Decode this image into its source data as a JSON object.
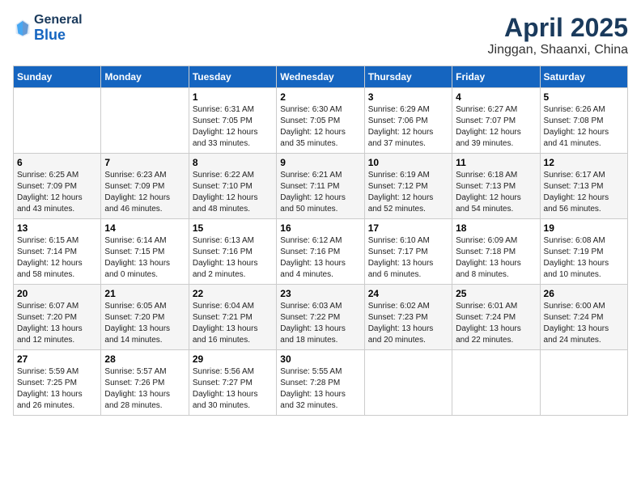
{
  "header": {
    "logo": {
      "general": "General",
      "blue": "Blue"
    },
    "title": "April 2025",
    "subtitle": "Jinggan, Shaanxi, China"
  },
  "days_of_week": [
    "Sunday",
    "Monday",
    "Tuesday",
    "Wednesday",
    "Thursday",
    "Friday",
    "Saturday"
  ],
  "weeks": [
    [
      {
        "day": "",
        "sunrise": "",
        "sunset": "",
        "daylight": ""
      },
      {
        "day": "",
        "sunrise": "",
        "sunset": "",
        "daylight": ""
      },
      {
        "day": "1",
        "sunrise": "Sunrise: 6:31 AM",
        "sunset": "Sunset: 7:05 PM",
        "daylight": "Daylight: 12 hours and 33 minutes."
      },
      {
        "day": "2",
        "sunrise": "Sunrise: 6:30 AM",
        "sunset": "Sunset: 7:05 PM",
        "daylight": "Daylight: 12 hours and 35 minutes."
      },
      {
        "day": "3",
        "sunrise": "Sunrise: 6:29 AM",
        "sunset": "Sunset: 7:06 PM",
        "daylight": "Daylight: 12 hours and 37 minutes."
      },
      {
        "day": "4",
        "sunrise": "Sunrise: 6:27 AM",
        "sunset": "Sunset: 7:07 PM",
        "daylight": "Daylight: 12 hours and 39 minutes."
      },
      {
        "day": "5",
        "sunrise": "Sunrise: 6:26 AM",
        "sunset": "Sunset: 7:08 PM",
        "daylight": "Daylight: 12 hours and 41 minutes."
      }
    ],
    [
      {
        "day": "6",
        "sunrise": "Sunrise: 6:25 AM",
        "sunset": "Sunset: 7:09 PM",
        "daylight": "Daylight: 12 hours and 43 minutes."
      },
      {
        "day": "7",
        "sunrise": "Sunrise: 6:23 AM",
        "sunset": "Sunset: 7:09 PM",
        "daylight": "Daylight: 12 hours and 46 minutes."
      },
      {
        "day": "8",
        "sunrise": "Sunrise: 6:22 AM",
        "sunset": "Sunset: 7:10 PM",
        "daylight": "Daylight: 12 hours and 48 minutes."
      },
      {
        "day": "9",
        "sunrise": "Sunrise: 6:21 AM",
        "sunset": "Sunset: 7:11 PM",
        "daylight": "Daylight: 12 hours and 50 minutes."
      },
      {
        "day": "10",
        "sunrise": "Sunrise: 6:19 AM",
        "sunset": "Sunset: 7:12 PM",
        "daylight": "Daylight: 12 hours and 52 minutes."
      },
      {
        "day": "11",
        "sunrise": "Sunrise: 6:18 AM",
        "sunset": "Sunset: 7:13 PM",
        "daylight": "Daylight: 12 hours and 54 minutes."
      },
      {
        "day": "12",
        "sunrise": "Sunrise: 6:17 AM",
        "sunset": "Sunset: 7:13 PM",
        "daylight": "Daylight: 12 hours and 56 minutes."
      }
    ],
    [
      {
        "day": "13",
        "sunrise": "Sunrise: 6:15 AM",
        "sunset": "Sunset: 7:14 PM",
        "daylight": "Daylight: 12 hours and 58 minutes."
      },
      {
        "day": "14",
        "sunrise": "Sunrise: 6:14 AM",
        "sunset": "Sunset: 7:15 PM",
        "daylight": "Daylight: 13 hours and 0 minutes."
      },
      {
        "day": "15",
        "sunrise": "Sunrise: 6:13 AM",
        "sunset": "Sunset: 7:16 PM",
        "daylight": "Daylight: 13 hours and 2 minutes."
      },
      {
        "day": "16",
        "sunrise": "Sunrise: 6:12 AM",
        "sunset": "Sunset: 7:16 PM",
        "daylight": "Daylight: 13 hours and 4 minutes."
      },
      {
        "day": "17",
        "sunrise": "Sunrise: 6:10 AM",
        "sunset": "Sunset: 7:17 PM",
        "daylight": "Daylight: 13 hours and 6 minutes."
      },
      {
        "day": "18",
        "sunrise": "Sunrise: 6:09 AM",
        "sunset": "Sunset: 7:18 PM",
        "daylight": "Daylight: 13 hours and 8 minutes."
      },
      {
        "day": "19",
        "sunrise": "Sunrise: 6:08 AM",
        "sunset": "Sunset: 7:19 PM",
        "daylight": "Daylight: 13 hours and 10 minutes."
      }
    ],
    [
      {
        "day": "20",
        "sunrise": "Sunrise: 6:07 AM",
        "sunset": "Sunset: 7:20 PM",
        "daylight": "Daylight: 13 hours and 12 minutes."
      },
      {
        "day": "21",
        "sunrise": "Sunrise: 6:05 AM",
        "sunset": "Sunset: 7:20 PM",
        "daylight": "Daylight: 13 hours and 14 minutes."
      },
      {
        "day": "22",
        "sunrise": "Sunrise: 6:04 AM",
        "sunset": "Sunset: 7:21 PM",
        "daylight": "Daylight: 13 hours and 16 minutes."
      },
      {
        "day": "23",
        "sunrise": "Sunrise: 6:03 AM",
        "sunset": "Sunset: 7:22 PM",
        "daylight": "Daylight: 13 hours and 18 minutes."
      },
      {
        "day": "24",
        "sunrise": "Sunrise: 6:02 AM",
        "sunset": "Sunset: 7:23 PM",
        "daylight": "Daylight: 13 hours and 20 minutes."
      },
      {
        "day": "25",
        "sunrise": "Sunrise: 6:01 AM",
        "sunset": "Sunset: 7:24 PM",
        "daylight": "Daylight: 13 hours and 22 minutes."
      },
      {
        "day": "26",
        "sunrise": "Sunrise: 6:00 AM",
        "sunset": "Sunset: 7:24 PM",
        "daylight": "Daylight: 13 hours and 24 minutes."
      }
    ],
    [
      {
        "day": "27",
        "sunrise": "Sunrise: 5:59 AM",
        "sunset": "Sunset: 7:25 PM",
        "daylight": "Daylight: 13 hours and 26 minutes."
      },
      {
        "day": "28",
        "sunrise": "Sunrise: 5:57 AM",
        "sunset": "Sunset: 7:26 PM",
        "daylight": "Daylight: 13 hours and 28 minutes."
      },
      {
        "day": "29",
        "sunrise": "Sunrise: 5:56 AM",
        "sunset": "Sunset: 7:27 PM",
        "daylight": "Daylight: 13 hours and 30 minutes."
      },
      {
        "day": "30",
        "sunrise": "Sunrise: 5:55 AM",
        "sunset": "Sunset: 7:28 PM",
        "daylight": "Daylight: 13 hours and 32 minutes."
      },
      {
        "day": "",
        "sunrise": "",
        "sunset": "",
        "daylight": ""
      },
      {
        "day": "",
        "sunrise": "",
        "sunset": "",
        "daylight": ""
      },
      {
        "day": "",
        "sunrise": "",
        "sunset": "",
        "daylight": ""
      }
    ]
  ]
}
